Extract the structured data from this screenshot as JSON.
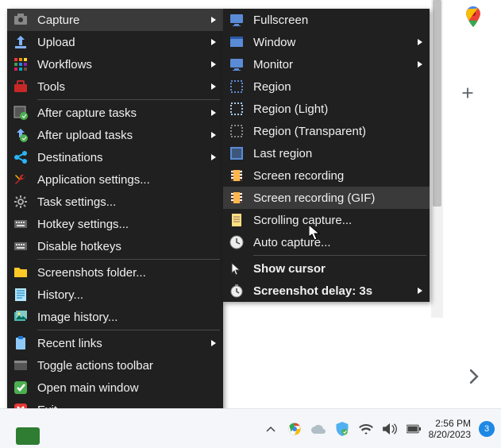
{
  "main": {
    "items": [
      {
        "label": "Capture",
        "icon": "camera-icon",
        "submenu": true,
        "highlight": true
      },
      {
        "label": "Upload",
        "icon": "upload-icon",
        "submenu": true
      },
      {
        "label": "Workflows",
        "icon": "grid-icon",
        "submenu": true
      },
      {
        "label": "Tools",
        "icon": "toolbox-icon",
        "submenu": true
      }
    ],
    "items2": [
      {
        "label": "After capture tasks",
        "icon": "screenshot-after-icon",
        "submenu": true
      },
      {
        "label": "After upload tasks",
        "icon": "upload-after-icon",
        "submenu": true
      },
      {
        "label": "Destinations",
        "icon": "share-icon",
        "submenu": true
      },
      {
        "label": "Application settings...",
        "icon": "wrench-icon"
      },
      {
        "label": "Task settings...",
        "icon": "gear-icon"
      },
      {
        "label": "Hotkey settings...",
        "icon": "keyboard-icon"
      },
      {
        "label": "Disable hotkeys",
        "icon": "keyboard-icon"
      }
    ],
    "items3": [
      {
        "label": "Screenshots folder...",
        "icon": "folder-icon"
      },
      {
        "label": "History...",
        "icon": "history-icon"
      },
      {
        "label": "Image history...",
        "icon": "images-icon"
      }
    ],
    "items4": [
      {
        "label": "Recent links",
        "icon": "clipboard-icon",
        "submenu": true
      },
      {
        "label": "Toggle actions toolbar",
        "icon": "toolbar-icon"
      },
      {
        "label": "Open main window",
        "icon": "check-icon"
      },
      {
        "label": "Exit",
        "icon": "close-icon"
      }
    ]
  },
  "sub": {
    "items": [
      {
        "label": "Fullscreen",
        "icon": "monitor-icon"
      },
      {
        "label": "Window",
        "icon": "window-icon",
        "submenu": true
      },
      {
        "label": "Monitor",
        "icon": "monitor-icon",
        "submenu": true
      },
      {
        "label": "Region",
        "icon": "region-icon"
      },
      {
        "label": "Region (Light)",
        "icon": "region-light-icon"
      },
      {
        "label": "Region (Transparent)",
        "icon": "region-trans-icon"
      },
      {
        "label": "Last region",
        "icon": "region-last-icon"
      },
      {
        "label": "Screen recording",
        "icon": "film-icon"
      },
      {
        "label": "Screen recording (GIF)",
        "icon": "film-icon",
        "highlight": true
      },
      {
        "label": "Scrolling capture...",
        "icon": "scroll-icon"
      },
      {
        "label": "Auto capture...",
        "icon": "clock-icon"
      }
    ],
    "items2": [
      {
        "label": "Show cursor",
        "icon": "cursor-icon",
        "bold": true
      },
      {
        "label": "Screenshot delay: 3s",
        "icon": "delay-icon",
        "submenu": true,
        "bold": true
      }
    ]
  },
  "taskbar": {
    "time": "2:56 PM",
    "date": "8/20/2023",
    "notif_count": "3"
  }
}
